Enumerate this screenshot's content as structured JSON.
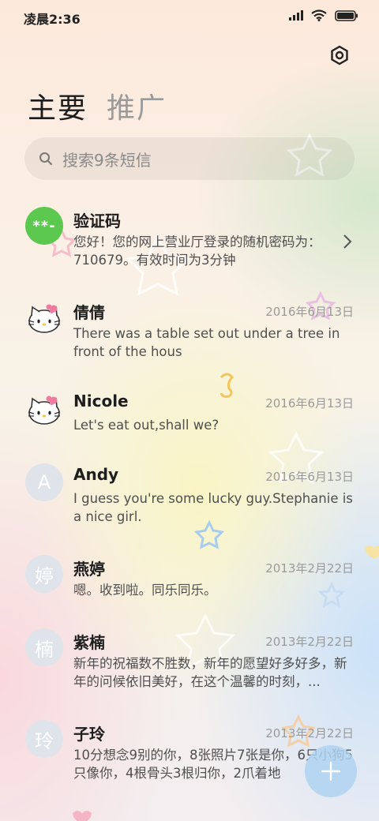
{
  "status_bar": {
    "time": "凌晨2:36",
    "icons": [
      "signal-icon",
      "wifi-icon",
      "battery-icon"
    ]
  },
  "tabs": {
    "main": "主要",
    "promo": "推广"
  },
  "search": {
    "placeholder": "搜索9条短信"
  },
  "messages": [
    {
      "avatar_type": "letter",
      "avatar_text": "**-",
      "name": "验证码",
      "date": "",
      "preview": "您好！您的网上营业厅登录的随机密码为：710679。有效时间为3分钟"
    },
    {
      "avatar_type": "kitty",
      "avatar_text": "",
      "name": "倩倩",
      "date": "2016年6月13日",
      "preview": "There was a table set out under a tree in front of the hous"
    },
    {
      "avatar_type": "kitty",
      "avatar_text": "",
      "name": "Nicole",
      "date": "2016年6月13日",
      "preview": "Let's eat out,shall we?"
    },
    {
      "avatar_type": "letter",
      "avatar_text": "A",
      "name": "Andy",
      "date": "2016年6月13日",
      "preview": "I guess you're some lucky guy.Stephanie is a nice girl."
    },
    {
      "avatar_type": "letter",
      "avatar_text": "婷",
      "name": "燕婷",
      "date": "2013年2月22日",
      "preview": "嗯。收到啦。同乐同乐。"
    },
    {
      "avatar_type": "letter",
      "avatar_text": "楠",
      "name": "紫楠",
      "date": "2013年2月22日",
      "preview": "新年的祝福数不胜数，新年的愿望好多好多，新年的问候依旧美好，在这个温馨的时刻，..."
    },
    {
      "avatar_type": "letter",
      "avatar_text": "玲",
      "name": "子玲",
      "date": "2013年2月22日",
      "preview": "10分想念9别的你，8张照片7张是你，6只小狗5只像你，4根骨头3根归你，2爪着地"
    }
  ],
  "colors": {
    "accent_green": "#5cc84f",
    "avatar_gray": "#dfe3ea",
    "fab_blue": "#afd2f0"
  }
}
